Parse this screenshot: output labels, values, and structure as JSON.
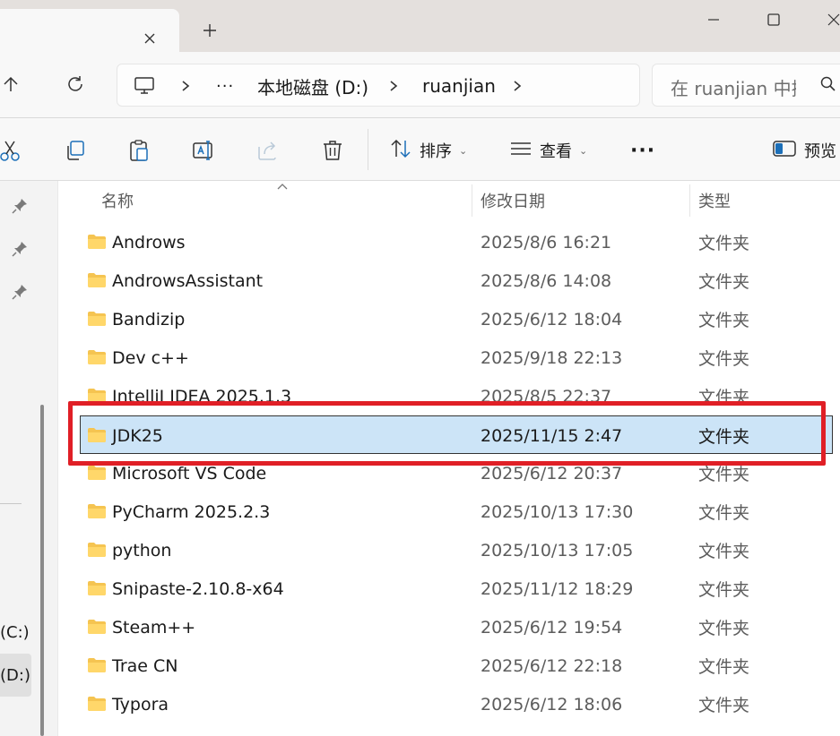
{
  "colors": {
    "highlight": "#e01f26",
    "selection": "#cce4f7",
    "folder": "#f5c451"
  },
  "icons": [
    "close-icon",
    "plus-icon",
    "minimize-icon",
    "maximize-icon",
    "up-arrow-icon",
    "refresh-icon",
    "computer-icon",
    "chevron-right-icon",
    "more-icon",
    "search-icon",
    "cut-icon",
    "copy-icon",
    "paste-icon",
    "rename-icon",
    "share-icon",
    "delete-icon",
    "sort-icon",
    "view-icon",
    "preview-icon",
    "pin-icon",
    "folder-icon"
  ],
  "addressbar": {
    "ellipsis": "···",
    "crumbs": [
      "本地磁盘 (D:)",
      "ruanjian"
    ]
  },
  "search": {
    "placeholder": "在 ruanjian 中搜"
  },
  "toolbar": {
    "sort_label": "排序",
    "view_label": "查看",
    "more_label": "···",
    "preview_label": "预览"
  },
  "nav": {
    "drives": [
      "(C:)",
      "(D:)"
    ]
  },
  "columns": {
    "name": "名称",
    "date": "修改日期",
    "type": "类型"
  },
  "files": [
    {
      "name": "Androws",
      "date": "2025/8/6 16:21",
      "type": "文件夹"
    },
    {
      "name": "AndrowsAssistant",
      "date": "2025/8/6 14:08",
      "type": "文件夹"
    },
    {
      "name": "Bandizip",
      "date": "2025/6/12 18:04",
      "type": "文件夹"
    },
    {
      "name": "Dev c++",
      "date": "2025/9/18 22:13",
      "type": "文件夹"
    },
    {
      "name": "IntelliJ IDEA 2025.1.3",
      "date": "2025/8/5 22:37",
      "type": "文件夹"
    },
    {
      "name": "JDK25",
      "date": "2025/11/15 2:47",
      "type": "文件夹"
    },
    {
      "name": "Microsoft VS Code",
      "date": "2025/6/12 20:37",
      "type": "文件夹"
    },
    {
      "name": "PyCharm 2025.2.3",
      "date": "2025/10/13 17:30",
      "type": "文件夹"
    },
    {
      "name": "python",
      "date": "2025/10/13 17:05",
      "type": "文件夹"
    },
    {
      "name": "Snipaste-2.10.8-x64",
      "date": "2025/11/12 18:29",
      "type": "文件夹"
    },
    {
      "name": "Steam++",
      "date": "2025/6/12 19:54",
      "type": "文件夹"
    },
    {
      "name": "Trae CN",
      "date": "2025/6/12 22:18",
      "type": "文件夹"
    },
    {
      "name": "Typora",
      "date": "2025/6/12 18:06",
      "type": "文件夹"
    }
  ],
  "selected_file": "JDK25"
}
